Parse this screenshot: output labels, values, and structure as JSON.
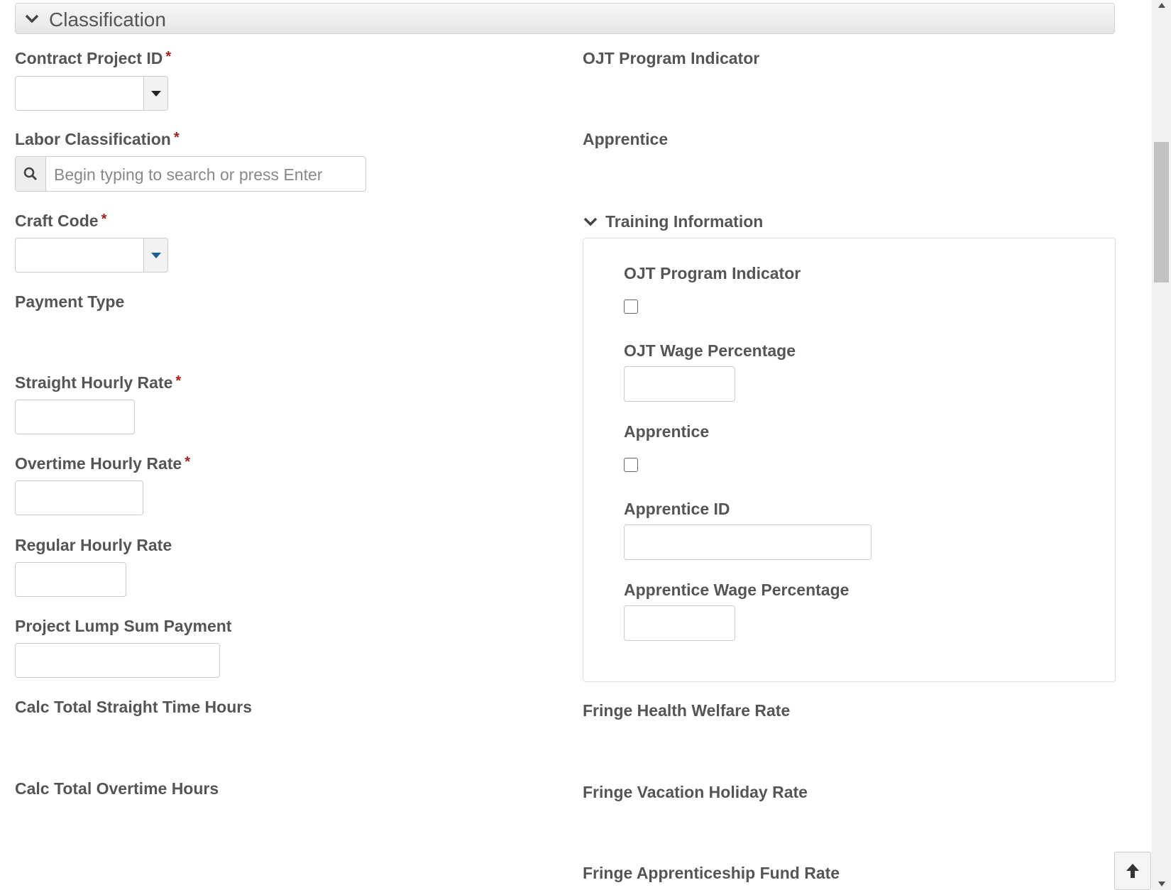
{
  "section": {
    "title": "Classification"
  },
  "left": {
    "contract_project_id": {
      "label": "Contract Project ID",
      "required": "*"
    },
    "labor_classification": {
      "label": "Labor Classification",
      "required": "*",
      "placeholder": "Begin typing to search or press Enter"
    },
    "craft_code": {
      "label": "Craft Code",
      "required": "*"
    },
    "payment_type": {
      "label": "Payment Type"
    },
    "straight_hourly_rate": {
      "label": "Straight Hourly Rate",
      "required": "*"
    },
    "overtime_hourly_rate": {
      "label": "Overtime Hourly Rate",
      "required": "*"
    },
    "regular_hourly_rate": {
      "label": "Regular Hourly Rate"
    },
    "project_lump_sum_payment": {
      "label": "Project Lump Sum Payment"
    },
    "calc_total_straight_time_hours": {
      "label": "Calc Total Straight Time Hours"
    },
    "calc_total_overtime_hours": {
      "label": "Calc Total Overtime Hours"
    }
  },
  "right": {
    "ojt_program_indicator": {
      "label": "OJT Program Indicator"
    },
    "apprentice": {
      "label": "Apprentice"
    },
    "training_information": {
      "title": "Training Information",
      "ojt_program_indicator": {
        "label": "OJT Program Indicator",
        "checked": false
      },
      "ojt_wage_percentage": {
        "label": "OJT Wage Percentage"
      },
      "apprentice": {
        "label": "Apprentice",
        "checked": false
      },
      "apprentice_id": {
        "label": "Apprentice ID"
      },
      "apprentice_wage_percentage": {
        "label": "Apprentice Wage Percentage"
      }
    },
    "fringe_health_welfare_rate": {
      "label": "Fringe Health Welfare Rate"
    },
    "fringe_vacation_holiday_rate": {
      "label": "Fringe Vacation Holiday Rate"
    },
    "fringe_apprenticeship_fund_rate": {
      "label": "Fringe Apprenticeship Fund Rate"
    }
  },
  "colors": {
    "required": "#a81c1c",
    "label": "#555555",
    "border": "#cccccc",
    "dropdown_caret_blue": "#1a5fa0"
  },
  "icons": {
    "section_toggle": "chevron-down-icon",
    "search": "search-icon",
    "dropdown": "caret-down-icon",
    "scroll_top": "arrow-up-icon"
  }
}
